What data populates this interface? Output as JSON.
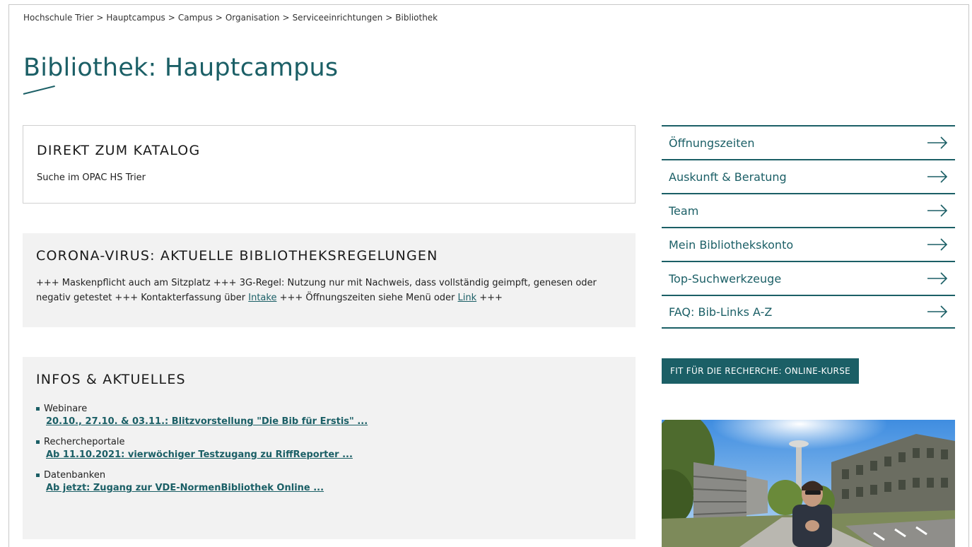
{
  "breadcrumb": {
    "items": [
      "Hochschule Trier",
      "Hauptcampus",
      "Campus",
      "Organisation",
      "Serviceeinrichtungen",
      "Bibliothek"
    ],
    "separator": ">"
  },
  "page": {
    "title": "Bibliothek: Hauptcampus"
  },
  "katalog": {
    "heading": "DIREKT ZUM KATALOG",
    "link_text": "Suche im OPAC HS Trier"
  },
  "corona": {
    "heading": "CORONA-VIRUS: AKTUELLE BIBLIOTHEKSREGELUNGEN",
    "text_part1": "+++ Maskenpflicht auch am Sitzplatz +++ 3G-Regel: Nutzung nur mit Nachweis, dass vollständig geimpft, genesen oder negativ getestet +++ Kontakterfassung über ",
    "link1": "Intake",
    "text_part2": " +++ Öffnungszeiten siehe Menü oder ",
    "link2": "Link",
    "text_part3": " +++"
  },
  "infos": {
    "heading": "INFOS & AKTUELLES",
    "items": [
      {
        "category": "Webinare",
        "link": "20.10., 27.10. & 03.11.: Blitzvorstellung \"Die Bib für Erstis\" ..."
      },
      {
        "category": "Rechercheportale",
        "link": "Ab 11.10.2021: vierwöchiger Testzugang zu RiffReporter ..."
      },
      {
        "category": "Datenbanken",
        "link": "Ab jetzt: Zugang zur VDE-NormenBibliothek Online ..."
      }
    ]
  },
  "side_nav": {
    "items": [
      {
        "label": "Öffnungszeiten"
      },
      {
        "label": "Auskunft & Beratung"
      },
      {
        "label": "Team"
      },
      {
        "label": "Mein Bibliothekskonto"
      },
      {
        "label": "Top-Suchwerkzeuge"
      },
      {
        "label": "FAQ: Bib-Links A-Z"
      }
    ],
    "icon": "arrow-right-icon"
  },
  "fit_button": {
    "label": "FIT FÜR DIE RECHERCHE: ONLINE-KURSE"
  },
  "colors": {
    "accent": "#1b5f66",
    "panel": "#f2f2f2",
    "border": "#d0d0d0"
  }
}
